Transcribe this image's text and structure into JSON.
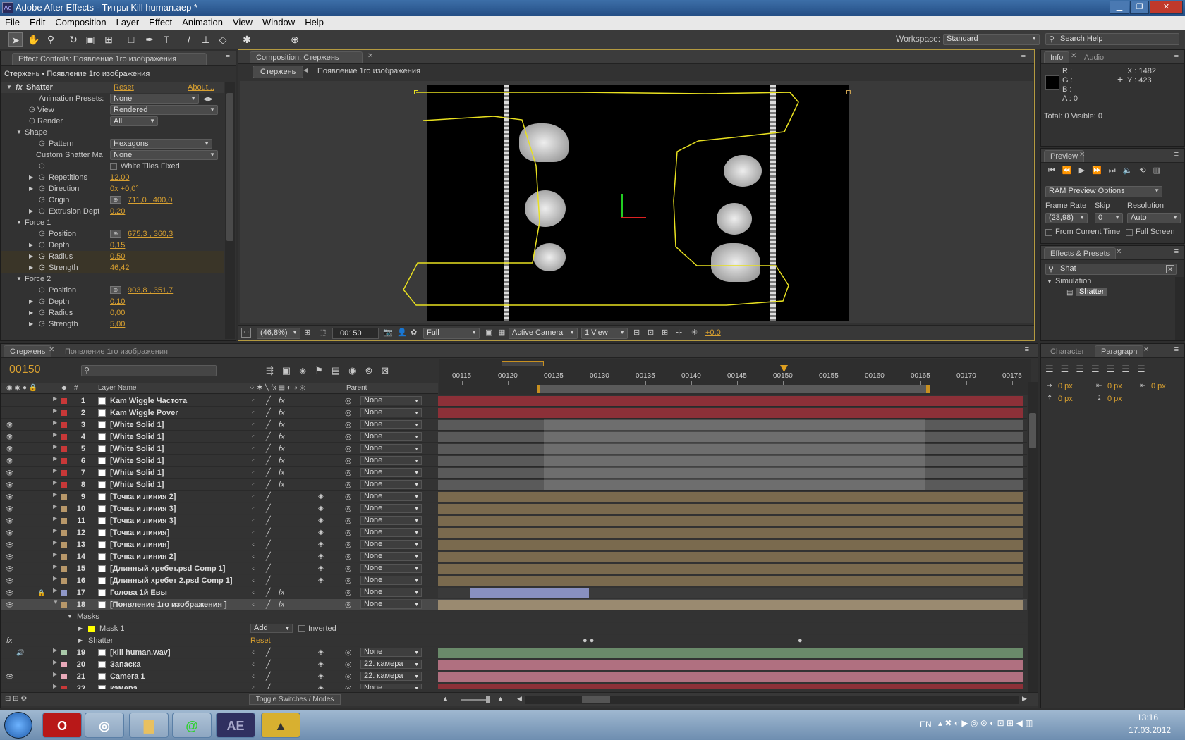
{
  "window": {
    "title": "Adobe After Effects - Титры Kill human.aep *"
  },
  "menu": [
    "File",
    "Edit",
    "Composition",
    "Layer",
    "Effect",
    "Animation",
    "View",
    "Window",
    "Help"
  ],
  "workspace": {
    "label": "Workspace:",
    "value": "Standard"
  },
  "search_help": {
    "placeholder": "Search Help"
  },
  "effect_controls": {
    "tab": "Effect Controls: Появление 1го изображения",
    "breadcrumb": "Стержень • Появление 1го изображения",
    "effect_name": "Shatter",
    "reset": "Reset",
    "about": "About...",
    "animation_presets": {
      "label": "Animation Presets:",
      "value": "None"
    },
    "view": {
      "label": "View",
      "value": "Rendered"
    },
    "render": {
      "label": "Render",
      "value": "All"
    },
    "shape_label": "Shape",
    "pattern": {
      "label": "Pattern",
      "value": "Hexagons"
    },
    "custom_shatter": {
      "label": "Custom Shatter Ma",
      "value": "None"
    },
    "white_tiles": "White Tiles Fixed",
    "repetitions": {
      "label": "Repetitions",
      "value": "12,00"
    },
    "direction": {
      "label": "Direction",
      "value": "0x +0,0°"
    },
    "origin": {
      "label": "Origin",
      "value": "711,0 , 400,0"
    },
    "extrusion": {
      "label": "Extrusion Dept",
      "value": "0,20"
    },
    "force1": {
      "label": "Force 1",
      "position": "675,3 , 360,3",
      "depth": "0,15",
      "radius": "0,50",
      "strength": "46,42"
    },
    "force2": {
      "label": "Force 2",
      "position": "903,8 , 351,7",
      "depth": "0,10",
      "radius": "0,00",
      "strength": "5,00"
    },
    "labels": {
      "position": "Position",
      "depth": "Depth",
      "radius": "Radius",
      "strength": "Strength"
    }
  },
  "composition": {
    "tab": "Composition: Стержень",
    "crumb_active": "Стержень",
    "crumb_child": "Появление 1го изображения",
    "zoom": "(46,8%)",
    "timecode": "00150",
    "resolution": "Full",
    "camera": "Active Camera",
    "views": "1 View",
    "exposure": "+0,0"
  },
  "info": {
    "tab": "Info",
    "tab2": "Audio",
    "r": "R :",
    "g": "G :",
    "b": "B :",
    "a": "A : 0",
    "x": "X : 1482",
    "y": "Y : 423",
    "total": "Total: 0   Visible: 0"
  },
  "preview": {
    "tab": "Preview",
    "ram": "RAM Preview Options",
    "frame_rate_label": "Frame Rate",
    "skip_label": "Skip",
    "resolution_label": "Resolution",
    "frame_rate": "(23,98)",
    "skip": "0",
    "resolution": "Auto",
    "from_current": "From Current Time",
    "full_screen": "Full Screen"
  },
  "effects_presets": {
    "tab": "Effects & Presets",
    "search": "Shat",
    "category": "Simulation",
    "item": "Shatter"
  },
  "char_para": {
    "tab1": "Character",
    "tab2": "Paragraph",
    "vals": [
      "0 px",
      "0 px",
      "0 px",
      "0 px",
      "0 px"
    ]
  },
  "timeline": {
    "tab1": "Стержень",
    "tab2": "Появление 1го изображения",
    "timecode": "00150",
    "col_layer": "Layer Name",
    "col_num": "#",
    "col_parent": "Parent",
    "ruler": [
      "00115",
      "00120",
      "00125",
      "00130",
      "00135",
      "00140",
      "00145",
      "00150",
      "00155",
      "00160",
      "00165",
      "00170",
      "00175"
    ],
    "layers": [
      {
        "n": "1",
        "name": "Kam Wiggle Частота",
        "color": "#c83838",
        "parent": "None",
        "bar": "#8c3038",
        "fx": true
      },
      {
        "n": "2",
        "name": "Kam Wiggle Pover",
        "color": "#c83838",
        "parent": "None",
        "bar": "#8c3038",
        "fx": true
      },
      {
        "n": "3",
        "name": "[White Solid 1]",
        "color": "#c83838",
        "parent": "None",
        "bar": "#5a5a5a",
        "fx": true
      },
      {
        "n": "4",
        "name": "[White Solid 1]",
        "color": "#c83838",
        "parent": "None",
        "bar": "#5a5a5a",
        "fx": true
      },
      {
        "n": "5",
        "name": "[White Solid 1]",
        "color": "#c83838",
        "parent": "None",
        "bar": "#5a5a5a",
        "fx": true
      },
      {
        "n": "6",
        "name": "[White Solid 1]",
        "color": "#c83838",
        "parent": "None",
        "bar": "#5a5a5a",
        "fx": true
      },
      {
        "n": "7",
        "name": "[White Solid 1]",
        "color": "#c83838",
        "parent": "None",
        "bar": "#5a5a5a",
        "fx": true
      },
      {
        "n": "8",
        "name": "[White Solid 1]",
        "color": "#c83838",
        "parent": "None",
        "bar": "#5a5a5a",
        "fx": true
      },
      {
        "n": "9",
        "name": "[Точка и линия 2]",
        "color": "#b8986a",
        "parent": "None",
        "bar": "#7a6a4e",
        "fx": false
      },
      {
        "n": "10",
        "name": "[Точка и линия 3]",
        "color": "#b8986a",
        "parent": "None",
        "bar": "#7a6a4e",
        "fx": false
      },
      {
        "n": "11",
        "name": "[Точка и линия 3]",
        "color": "#b8986a",
        "parent": "None",
        "bar": "#7a6a4e",
        "fx": false
      },
      {
        "n": "12",
        "name": "[Точка и линия]",
        "color": "#b8986a",
        "parent": "None",
        "bar": "#7a6a4e",
        "fx": false
      },
      {
        "n": "13",
        "name": "[Точка и линия]",
        "color": "#b8986a",
        "parent": "None",
        "bar": "#7a6a4e",
        "fx": false
      },
      {
        "n": "14",
        "name": "[Точка и линия 2]",
        "color": "#b8986a",
        "parent": "None",
        "bar": "#7a6a4e",
        "fx": false
      },
      {
        "n": "15",
        "name": "[Длинный хребет.psd Comp 1]",
        "color": "#b8986a",
        "parent": "None",
        "bar": "#7a6a4e",
        "fx": false
      },
      {
        "n": "16",
        "name": "[Длинный хребет 2.psd Comp 1]",
        "color": "#b8986a",
        "parent": "None",
        "bar": "#7a6a4e",
        "fx": false
      },
      {
        "n": "17",
        "name": "Голова 1й Евы",
        "color": "#9098c8",
        "parent": "None",
        "bar": "#3a3a3a",
        "fx": true
      },
      {
        "n": "18",
        "name": "[Появление 1го изображения ]",
        "color": "#b8986a",
        "parent": "None",
        "bar": "#9a8a70",
        "fx": true
      }
    ],
    "masks_label": "Masks",
    "mask1": "Mask 1",
    "mask_mode": "Add",
    "inverted": "Inverted",
    "shatter_label": "Shatter",
    "shatter_reset": "Reset",
    "layers2": [
      {
        "n": "19",
        "name": "[kill human.wav]",
        "color": "#a8c8a8",
        "parent": "None",
        "bar": "#6a8a6a"
      },
      {
        "n": "20",
        "name": "Запаска",
        "color": "#e8a8b8",
        "parent": "22. камера",
        "bar": "#b07080"
      },
      {
        "n": "21",
        "name": "Camera 1",
        "color": "#e8a8b8",
        "parent": "22. камера",
        "bar": "#b07080"
      },
      {
        "n": "22",
        "name": "камера",
        "color": "#c83838",
        "parent": "None",
        "bar": "#8c3038"
      }
    ],
    "toggle": "Toggle Switches / Modes"
  },
  "taskbar": {
    "lang": "EN",
    "time": "13:16",
    "date": "17.03.2012"
  }
}
